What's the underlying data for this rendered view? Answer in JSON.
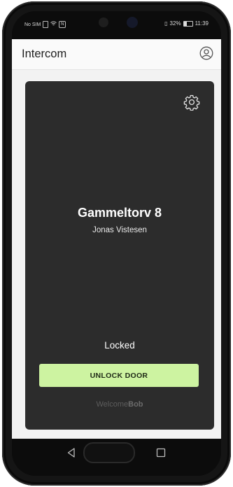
{
  "status_bar": {
    "carrier": "No SIM",
    "battery": "32%",
    "time": "11:39"
  },
  "app_bar": {
    "title": "Intercom",
    "account_icon": "account-circle-icon"
  },
  "door_card": {
    "settings_icon": "gear-icon",
    "location_name": "Gammeltorv 8",
    "owner_name": "Jonas Vistesen",
    "lock_status": "Locked",
    "unlock_label": "UNLOCK DOOR",
    "brand_prefix": "Welcome",
    "brand_suffix": "Bob",
    "colors": {
      "card_background": "#2c2c2c",
      "button_background": "#cdf3a1"
    }
  },
  "nav_bar": {
    "back_icon": "triangle-back-icon",
    "home_icon": "circle-home-icon",
    "recents_icon": "square-recents-icon"
  }
}
